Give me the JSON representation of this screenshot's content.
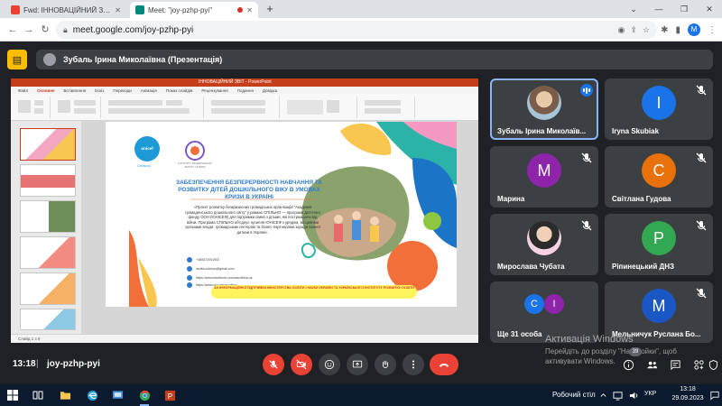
{
  "browser": {
    "tabs": [
      {
        "title": "Fwd: ІННОВАЦІЙНИЙ ЗВІТ - г...",
        "favicon_color": "#ea4335"
      },
      {
        "title": "Meet: \"joy-pzhp-pyi\"",
        "favicon_color": "#00897b"
      }
    ],
    "url": "meet.google.com/joy-pzhp-pyi",
    "profile_initial": "M"
  },
  "meet": {
    "presenter_label": "Зубаль Ірина Миколаївна (Презентація)",
    "time": "13:18",
    "separator": "|",
    "meeting_code": "joy-pzhp-pyi",
    "people_count": "39"
  },
  "presentation": {
    "app_title": "ІННОВАЦІЙНИЙ ЗВІТ - PowerPoint",
    "menus": [
      "Файл",
      "Основне",
      "Вставлення",
      "Ескіз",
      "Переходи",
      "Анімація",
      "Показ слайдів",
      "Рецензування",
      "Подання",
      "Довідка"
    ],
    "statusbar": "Слайд 1 з 9",
    "thumb_numbers": [
      "1",
      "2",
      "3",
      "4",
      "5",
      "6"
    ]
  },
  "slide": {
    "logo_text": "unicef",
    "logo_sub": "Спільно",
    "institute": "ІНСТИТУТ МОДЕРНІЗАЦІЇ ЗМІСТУ ОСВІТИ",
    "title": "ЗАБЕЗПЕЧЕННЯ БЕЗПЕРЕРВНОСТІ НАВЧАННЯ ТА РОЗВИТКУ ДІТЕЙ ДОШКІЛЬНОГО ВІКУ В УМОВАХ КРИЗИ В УКРАЇНІ",
    "body": "«Проєкт розвитку безкризисних громадських організацій \"Академія громадянського дошкільного світу\" у рамках СПІЛЬНО — програми Дитячого фонду ООН (ЮНІСЕФ) для підтримки сімей з дітьми, які постраждали від війни. Програма СПІЛЬНО об'єднує зусилля ЮНІСЕФ з урядом, місцевими органами влади, громадським сектором та бізнес-партнерами заради кожної дитини в Україні».",
    "contacts": [
      "+380672051902",
      "osvita.cubizov@gmail.com",
      "https://www.facebook.com/ascuibiss.ua",
      "https://www.ukr.net/ascuibiss"
    ],
    "banner": "ЗА ІНФОРМАЦІЙНОЇ ПІДТРИМКИ МІНІСТЕРСТВА ОСВІТИ І НАУКИ УКРАЇНИ ТА УКРАЇНСЬКОГО ІНСТИТУТУ РОЗВИТКУ ОСВІТИ"
  },
  "participants": [
    {
      "name": "Зубаль Ірина Миколаїв...",
      "initial": "",
      "color": "",
      "status": "speaking"
    },
    {
      "name": "Iryna Skubiak",
      "initial": "I",
      "color": "#1a73e8",
      "status": "muted"
    },
    {
      "name": "Марина",
      "initial": "M",
      "color": "#8e24aa",
      "status": "muted"
    },
    {
      "name": "Світлана Гудова",
      "initial": "C",
      "color": "#e8710a",
      "status": "muted"
    },
    {
      "name": "Мирослава Чубата",
      "initial": "",
      "color": "",
      "status": "muted"
    },
    {
      "name": "Ріпинецький ДНЗ",
      "initial": "P",
      "color": "#33a852",
      "status": "muted"
    },
    {
      "name": "Ще 31 особа",
      "initial": "С",
      "initial2": "I",
      "color": "#1a73e8",
      "color2": "#8e24aa",
      "status": "none"
    },
    {
      "name": "Мельничук Руслана Бо...",
      "initial": "M",
      "color": "#1a56c4",
      "status": "muted"
    }
  ],
  "watermark": {
    "title": "Активація Windows",
    "subtitle": "Перейдіть до розділу \"Настройки\", щоб активувати Windows."
  },
  "taskbar": {
    "tray_label": "Робочий стіл",
    "language": "УКР",
    "time": "13:18",
    "date": "29.09.2023"
  }
}
